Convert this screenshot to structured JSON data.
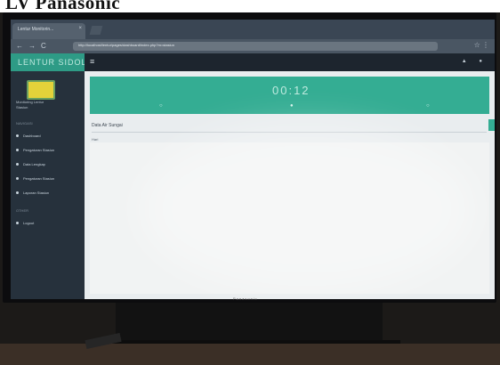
{
  "caption": {
    "text": "LV Panasonic"
  },
  "browser": {
    "tab_title": "Lentur Monitorin...",
    "tab_close": "×",
    "nav_back": "←",
    "nav_forward": "→",
    "nav_reload": "C",
    "url": "http://localhost/lentur/pages/dashboard/index.php?m=stasiun",
    "addr_icons": "☆ ⋮"
  },
  "app": {
    "brand": "LENTUR SIDOLO",
    "profile_line1": "Monitoring Lentur",
    "profile_line2": "Stasiun",
    "nav_section_1": "NAVIGASI",
    "nav_items": [
      {
        "label": "Dashboard"
      },
      {
        "label": "Pengaturan Stasiun"
      },
      {
        "label": "Data Lengkap"
      },
      {
        "label": "Pengaturan Stasiun"
      },
      {
        "label": "Laporan Stasiun"
      }
    ],
    "nav_section_2": "OTHER",
    "nav_other_items": [
      {
        "label": "Logout"
      }
    ],
    "topbar_menu_icon": "≡",
    "topbar_icons": "▲ ●",
    "banner_value": "00:12",
    "banner_marks": [
      "○",
      "●",
      "○"
    ],
    "section_title": "Data Air Sungai",
    "section_sub": "Hari",
    "colors": {
      "accent": "#34ad93",
      "sidebar": "#26313c",
      "topbar": "#1d252e"
    }
  },
  "tv": {
    "brand": "Panasonic"
  }
}
